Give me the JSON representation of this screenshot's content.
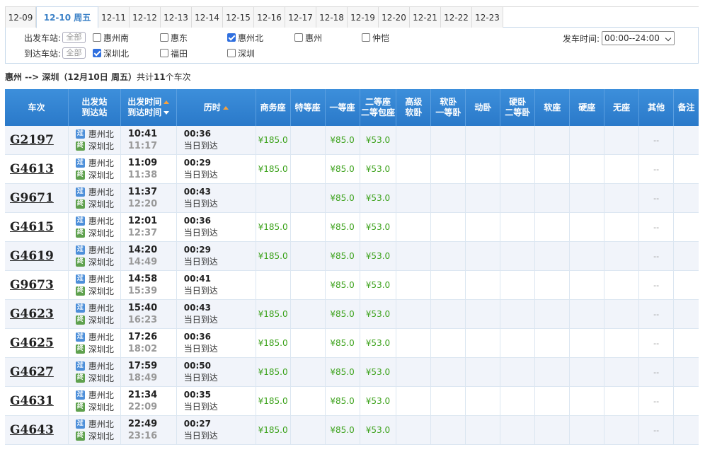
{
  "date_tabs": [
    {
      "label": "12-09",
      "active": false
    },
    {
      "label": "12-10 周五",
      "active": true
    },
    {
      "label": "12-11",
      "active": false
    },
    {
      "label": "12-12",
      "active": false
    },
    {
      "label": "12-13",
      "active": false
    },
    {
      "label": "12-14",
      "active": false
    },
    {
      "label": "12-15",
      "active": false
    },
    {
      "label": "12-16",
      "active": false
    },
    {
      "label": "12-17",
      "active": false
    },
    {
      "label": "12-18",
      "active": false
    },
    {
      "label": "12-19",
      "active": false
    },
    {
      "label": "12-20",
      "active": false
    },
    {
      "label": "12-21",
      "active": false
    },
    {
      "label": "12-22",
      "active": false
    },
    {
      "label": "12-23",
      "active": false
    }
  ],
  "filter": {
    "depart_label": "出发车站:",
    "arrive_label": "到达车站:",
    "all_label": "全部",
    "depart_options": [
      {
        "label": "惠州南",
        "checked": false
      },
      {
        "label": "惠东",
        "checked": false
      },
      {
        "label": "惠州北",
        "checked": true
      },
      {
        "label": "惠州",
        "checked": false
      },
      {
        "label": "仲恺",
        "checked": false
      }
    ],
    "arrive_options": [
      {
        "label": "深圳北",
        "checked": true
      },
      {
        "label": "福田",
        "checked": false
      },
      {
        "label": "深圳",
        "checked": false
      }
    ],
    "time_label": "发车时间:",
    "time_value": "00:00--24:00"
  },
  "summary": {
    "route": "惠州 --> 深圳",
    "date": "（12月10日  周五）",
    "prefix": "共计",
    "count": "11",
    "suffix": "个车次"
  },
  "table": {
    "headers": {
      "train": "车次",
      "station_top": "出发站",
      "station_bottom": "到达站",
      "time_top": "出发时间",
      "time_bottom": "到达时间",
      "duration": "历时",
      "business": "商务座",
      "premium": "特等座",
      "first": "一等座",
      "second_top": "二等座",
      "second_bottom": "二等包座",
      "deluxe_top": "高级",
      "deluxe_bottom": "软卧",
      "softsleep_top": "软卧",
      "softsleep_bottom": "一等卧",
      "dongwo": "动卧",
      "hardsleep_top": "硬卧",
      "hardsleep_bottom": "二等卧",
      "softseat": "软座",
      "hardseat": "硬座",
      "noseat": "无座",
      "other": "其他",
      "remark": "备注"
    },
    "badge_pass": "过",
    "badge_end": "终",
    "rows": [
      {
        "train": "G2197",
        "from": "惠州北",
        "to": "深圳北",
        "dep": "10:41",
        "arr": "11:17",
        "dur": "00:36",
        "arrive_day": "当日到达",
        "business": "¥185.0",
        "first": "¥85.0",
        "second": "¥53.0",
        "other": "--"
      },
      {
        "train": "G4613",
        "from": "惠州北",
        "to": "深圳北",
        "dep": "11:09",
        "arr": "11:38",
        "dur": "00:29",
        "arrive_day": "当日到达",
        "business": "¥185.0",
        "first": "¥85.0",
        "second": "¥53.0",
        "other": "--"
      },
      {
        "train": "G9671",
        "from": "惠州北",
        "to": "深圳北",
        "dep": "11:37",
        "arr": "12:20",
        "dur": "00:43",
        "arrive_day": "当日到达",
        "business": "",
        "first": "¥85.0",
        "second": "¥53.0",
        "other": "--"
      },
      {
        "train": "G4615",
        "from": "惠州北",
        "to": "深圳北",
        "dep": "12:01",
        "arr": "12:37",
        "dur": "00:36",
        "arrive_day": "当日到达",
        "business": "¥185.0",
        "first": "¥85.0",
        "second": "¥53.0",
        "other": "--"
      },
      {
        "train": "G4619",
        "from": "惠州北",
        "to": "深圳北",
        "dep": "14:20",
        "arr": "14:49",
        "dur": "00:29",
        "arrive_day": "当日到达",
        "business": "¥185.0",
        "first": "¥85.0",
        "second": "¥53.0",
        "other": "--"
      },
      {
        "train": "G9673",
        "from": "惠州北",
        "to": "深圳北",
        "dep": "14:58",
        "arr": "15:39",
        "dur": "00:41",
        "arrive_day": "当日到达",
        "business": "",
        "first": "¥85.0",
        "second": "¥53.0",
        "other": "--"
      },
      {
        "train": "G4623",
        "from": "惠州北",
        "to": "深圳北",
        "dep": "15:40",
        "arr": "16:23",
        "dur": "00:43",
        "arrive_day": "当日到达",
        "business": "¥185.0",
        "first": "¥85.0",
        "second": "¥53.0",
        "other": "--"
      },
      {
        "train": "G4625",
        "from": "惠州北",
        "to": "深圳北",
        "dep": "17:26",
        "arr": "18:02",
        "dur": "00:36",
        "arrive_day": "当日到达",
        "business": "¥185.0",
        "first": "¥85.0",
        "second": "¥53.0",
        "other": "--"
      },
      {
        "train": "G4627",
        "from": "惠州北",
        "to": "深圳北",
        "dep": "17:59",
        "arr": "18:49",
        "dur": "00:50",
        "arrive_day": "当日到达",
        "business": "¥185.0",
        "first": "¥85.0",
        "second": "¥53.0",
        "other": "--"
      },
      {
        "train": "G4631",
        "from": "惠州北",
        "to": "深圳北",
        "dep": "21:34",
        "arr": "22:09",
        "dur": "00:35",
        "arrive_day": "当日到达",
        "business": "¥185.0",
        "first": "¥85.0",
        "second": "¥53.0",
        "other": "--"
      },
      {
        "train": "G4643",
        "from": "惠州北",
        "to": "深圳北",
        "dep": "22:49",
        "arr": "23:16",
        "dur": "00:27",
        "arrive_day": "当日到达",
        "business": "¥185.0",
        "first": "¥85.0",
        "second": "¥53.0",
        "other": "--"
      }
    ]
  }
}
